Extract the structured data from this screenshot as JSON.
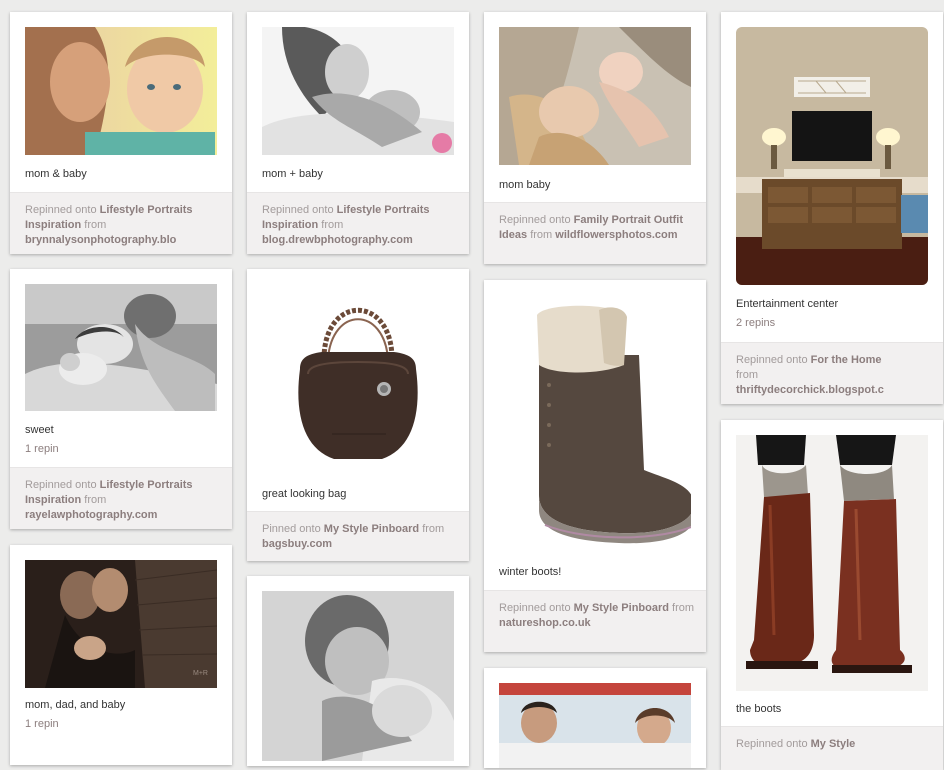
{
  "pins": [
    {
      "desc": "mom & baby",
      "repins": "",
      "verb": "Repinned onto",
      "board": "Lifestyle Portraits Inspiration",
      "from": "from",
      "source": "brynnalysonphotography.blo",
      "image": "mom-and-baby-photo"
    },
    {
      "desc": "sweet",
      "repins": "1 repin",
      "verb": "Repinned onto",
      "board": "Lifestyle Portraits Inspiration",
      "from": "from",
      "source": "rayelawphotography.com",
      "image": "family-newborn-photo"
    },
    {
      "desc": "mom, dad, and baby",
      "repins": "1 repin",
      "verb": "",
      "board": "",
      "from": "",
      "source": "",
      "image": "parents-baby-photo"
    },
    {
      "desc": "mom + baby",
      "repins": "",
      "verb": "Repinned onto",
      "board": "Lifestyle Portraits Inspiration",
      "from": "from",
      "source": "blog.drewbphotography.com",
      "image": "mother-newborn-photo"
    },
    {
      "desc": "great looking bag",
      "repins": "",
      "verb": "Pinned onto",
      "board": "My Style Pinboard",
      "from": "from",
      "source": "bagsbuy.com",
      "image": "brown-leather-bag-photo"
    },
    {
      "desc": "",
      "repins": "",
      "verb": "",
      "board": "",
      "from": "",
      "source": "",
      "image": "couple-embrace-photo"
    },
    {
      "desc": "mom baby",
      "repins": "",
      "verb": "Repinned onto",
      "board": "Family Portrait Outfit Ideas",
      "from": "from",
      "source": "wildflowersphotos.com",
      "image": "mother-lying-baby-photo"
    },
    {
      "desc": "winter boots!",
      "repins": "",
      "verb": "Repinned onto",
      "board": "My Style Pinboard",
      "from": "from",
      "source": "natureshop.co.uk",
      "image": "winter-boot-photo"
    },
    {
      "desc": "",
      "repins": "",
      "verb": "",
      "board": "",
      "from": "",
      "source": "",
      "image": "couple-bed-photo"
    },
    {
      "desc": "Entertainment center",
      "repins": "2 repins",
      "verb": "Repinned onto",
      "board": "For the Home",
      "from": "from",
      "source": "thriftydecorchick.blogspot.c",
      "image": "entertainment-center-photo"
    },
    {
      "desc": "the boots",
      "repins": "",
      "verb": "Repinned onto",
      "board": "My Style",
      "from": "",
      "source": "",
      "image": "riding-boots-photo"
    }
  ]
}
